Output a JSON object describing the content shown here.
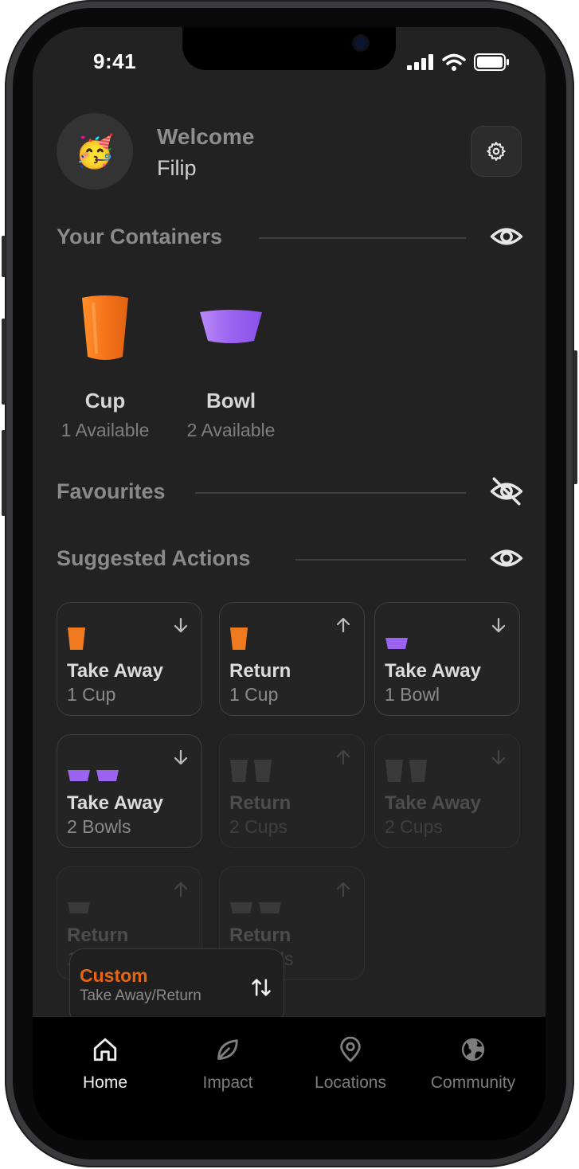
{
  "status_bar": {
    "time": "9:41"
  },
  "header": {
    "avatar_emoji": "🥳",
    "welcome": "Welcome",
    "username": "Filip"
  },
  "sections": {
    "containers": "Your Containers",
    "favourites": "Favourites",
    "suggested": "Suggested Actions"
  },
  "containers": [
    {
      "name": "Cup",
      "available": "1 Available",
      "color": "#f07a1f"
    },
    {
      "name": "Bowl",
      "available": "2 Available",
      "color": "#9a63f0"
    }
  ],
  "actions": [
    {
      "title": "Take Away",
      "sub": "1 Cup",
      "direction": "down",
      "icons": [
        "cup"
      ],
      "enabled": true
    },
    {
      "title": "Return",
      "sub": "1 Cup",
      "direction": "up",
      "icons": [
        "cup"
      ],
      "enabled": true
    },
    {
      "title": "Take Away",
      "sub": "1 Bowl",
      "direction": "down",
      "icons": [
        "bowl"
      ],
      "enabled": true
    },
    {
      "title": "Take Away",
      "sub": "2 Bowls",
      "direction": "down",
      "icons": [
        "bowl",
        "bowl"
      ],
      "enabled": true
    },
    {
      "title": "Return",
      "sub": "2 Cups",
      "direction": "up",
      "icons": [
        "cup",
        "cup"
      ],
      "enabled": false
    },
    {
      "title": "Take Away",
      "sub": "2 Cups",
      "direction": "down",
      "icons": [
        "cup",
        "cup"
      ],
      "enabled": false
    },
    {
      "title": "Return",
      "sub": "1 Bowl",
      "direction": "up",
      "icons": [
        "bowl"
      ],
      "enabled": false
    },
    {
      "title": "Return",
      "sub": "2 Bowls",
      "direction": "up",
      "icons": [
        "bowl",
        "bowl"
      ],
      "enabled": false
    }
  ],
  "custom": {
    "title": "Custom",
    "sub": "Take Away/Return"
  },
  "tabs": [
    {
      "label": "Home",
      "icon": "home-icon",
      "active": true
    },
    {
      "label": "Impact",
      "icon": "leaf-icon",
      "active": false
    },
    {
      "label": "Locations",
      "icon": "location-pin-icon",
      "active": false
    },
    {
      "label": "Community",
      "icon": "globe-icon",
      "active": false
    }
  ],
  "colors": {
    "cup": "#f07a1f",
    "bowl": "#9a63f0",
    "accent": "#e8650f",
    "background": "#222222"
  }
}
